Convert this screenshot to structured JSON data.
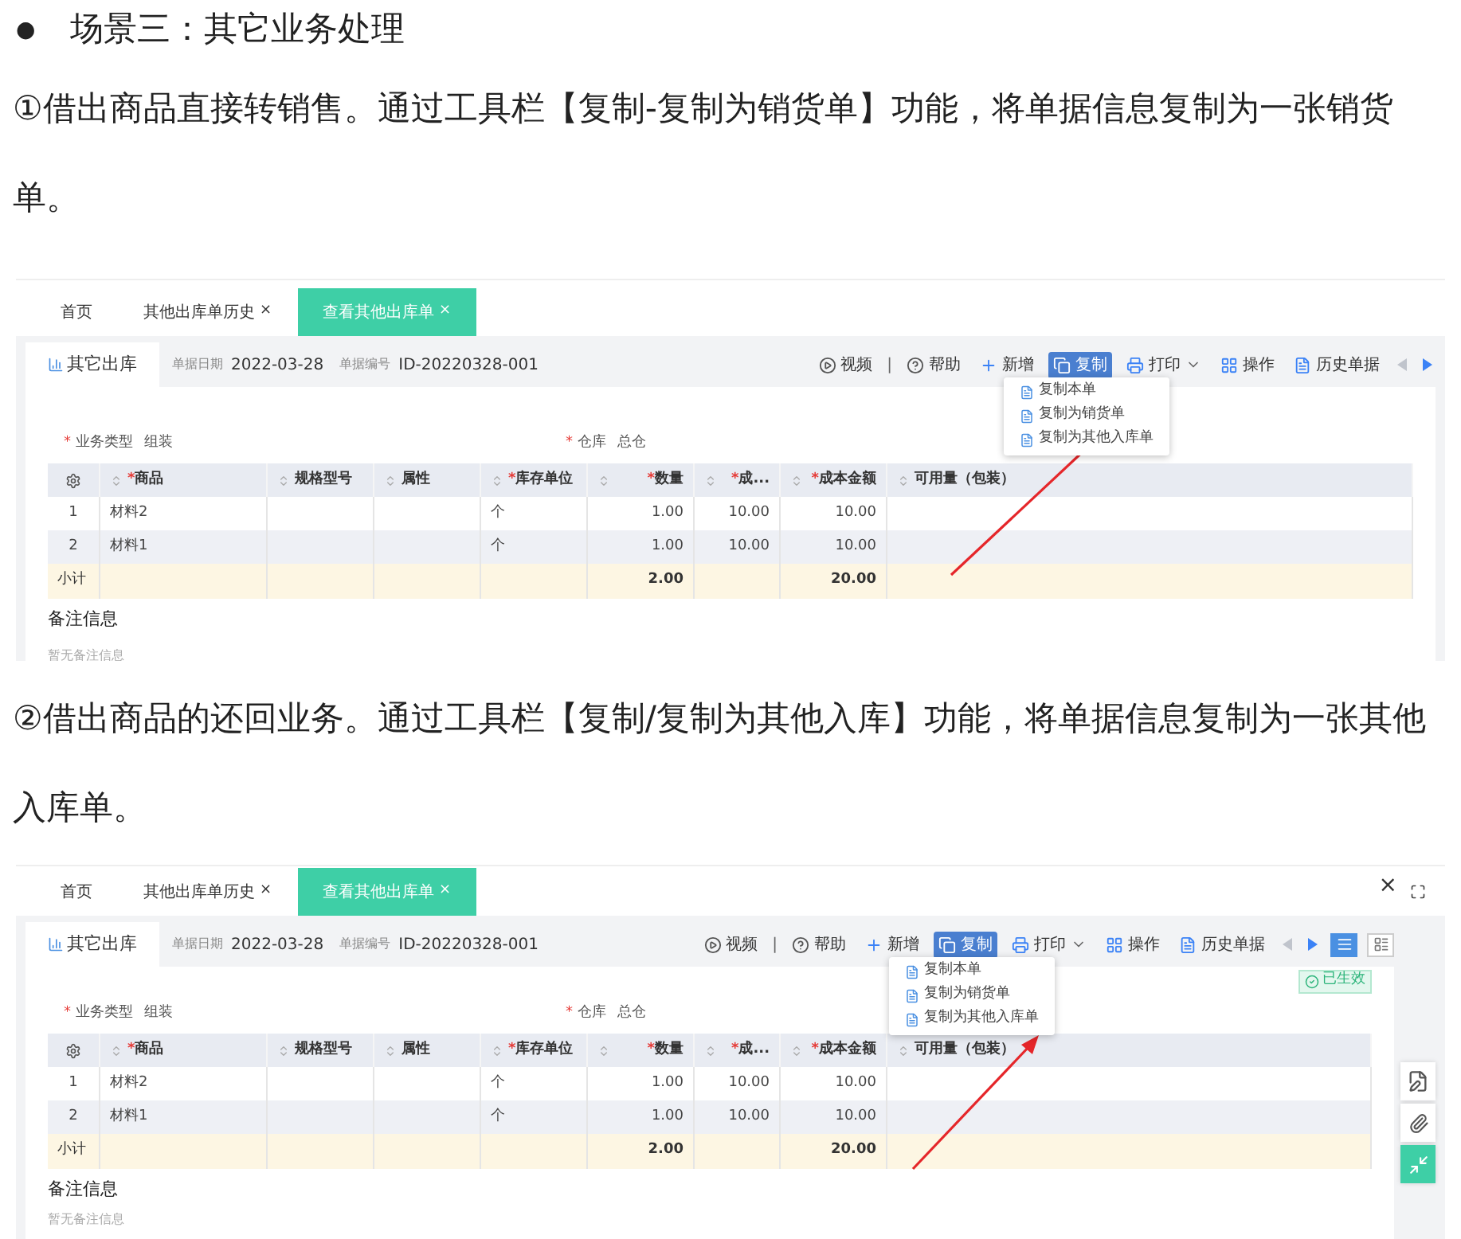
{
  "heading": {
    "bullet": "●",
    "text": "场景三：其它业务处理"
  },
  "sections": [
    {
      "instruction": "①借出商品直接转销售。通过工具栏【复制-复制为销货单】功能，将单据信息复制为一张销货单。",
      "screenshot": {
        "tabs": [
          {
            "label": "首页",
            "selected": false
          },
          {
            "label": "其他出库单历史",
            "close": "×",
            "selected": false
          },
          {
            "label": "查看其他出库单",
            "close": "×",
            "selected": true
          }
        ],
        "doc_tab": "其它出库",
        "date_label": "单据日期",
        "date": "2022-03-28",
        "number_label": "单据编号",
        "number": "ID-20220328-001",
        "toolbar": [
          {
            "kind": "video",
            "label": "视频"
          },
          {
            "kind": "separator",
            "label": "|"
          },
          {
            "kind": "help",
            "label": "帮助"
          },
          {
            "kind": "new",
            "label": "新增"
          },
          {
            "kind": "copy",
            "label": "复制",
            "selected": true,
            "menu": [
              "复制本单",
              "复制为销货单",
              "复制为其他入库单"
            ]
          },
          {
            "kind": "print",
            "label": "打印"
          },
          {
            "kind": "operate",
            "label": "操作"
          },
          {
            "kind": "history",
            "label": "历史单据"
          },
          {
            "kind": "prev"
          },
          {
            "kind": "next"
          }
        ],
        "fields": [
          {
            "mark": "*",
            "label": "业务类型",
            "value": "组装"
          },
          {
            "mark": "*",
            "label": "仓库",
            "value": "总仓"
          }
        ],
        "table": {
          "columns": [
            {
              "kind": "settings"
            },
            {
              "mark": "*",
              "label": "商品"
            },
            {
              "label": "规格型号"
            },
            {
              "label": "属性"
            },
            {
              "mark": "*",
              "label": "库存单位"
            },
            {
              "mark": "*",
              "label": "数量"
            },
            {
              "mark": "*",
              "label": "成..."
            },
            {
              "mark": "*",
              "label": "成本金额"
            },
            {
              "label": "可用量（包装）"
            }
          ],
          "rows": [
            {
              "index": "1",
              "product": "材料2",
              "unit": "个",
              "qty": "1.00",
              "cost": "10.00",
              "amount": "10.00"
            },
            {
              "index": "2",
              "product": "材料1",
              "unit": "个",
              "qty": "1.00",
              "cost": "10.00",
              "amount": "10.00"
            }
          ],
          "subtotal": {
            "label": "小计",
            "qty": "2.00",
            "amount": "20.00"
          }
        },
        "remarks_title": "备注信息",
        "remarks": "暂无备注信息",
        "pointer_arrow": true
      }
    },
    {
      "instruction": "②借出商品的还回业务。通过工具栏【复制/复制为其他入库】功能，将单据信息复制为一张其他入库单。",
      "screenshot": {
        "tabs": [
          {
            "label": "首页",
            "selected": false
          },
          {
            "label": "其他出库单历史",
            "close": "×",
            "selected": false
          },
          {
            "label": "查看其他出库单",
            "close": "×",
            "selected": true
          }
        ],
        "window_controls": [
          {
            "kind": "close",
            "label": "×"
          },
          {
            "kind": "fullscreen"
          }
        ],
        "doc_tab": "其它出库",
        "date_label": "单据日期",
        "date": "2022-03-28",
        "number_label": "单据编号",
        "number": "ID-20220328-001",
        "toolbar": [
          {
            "kind": "video",
            "label": "视频"
          },
          {
            "kind": "separator",
            "label": "|"
          },
          {
            "kind": "help",
            "label": "帮助"
          },
          {
            "kind": "new",
            "label": "新增"
          },
          {
            "kind": "copy",
            "label": "复制",
            "selected": true,
            "menu": [
              "复制本单",
              "复制为销货单",
              "复制为其他入库单"
            ]
          },
          {
            "kind": "print",
            "label": "打印"
          },
          {
            "kind": "operate",
            "label": "操作"
          },
          {
            "kind": "history",
            "label": "历史单据"
          },
          {
            "kind": "prev"
          },
          {
            "kind": "next"
          },
          {
            "kind": "list-view",
            "selected": true
          },
          {
            "kind": "card-view",
            "selected": false
          }
        ],
        "status_badge": "已生效",
        "fields": [
          {
            "mark": "*",
            "label": "业务类型",
            "value": "组装"
          },
          {
            "mark": "*",
            "label": "仓库",
            "value": "总仓"
          }
        ],
        "table": {
          "columns": [
            {
              "kind": "settings"
            },
            {
              "mark": "*",
              "label": "商品"
            },
            {
              "label": "规格型号"
            },
            {
              "label": "属性"
            },
            {
              "mark": "*",
              "label": "库存单位"
            },
            {
              "mark": "*",
              "label": "数量"
            },
            {
              "mark": "*",
              "label": "成..."
            },
            {
              "mark": "*",
              "label": "成本金额"
            },
            {
              "label": "可用量（包装）"
            }
          ],
          "rows": [
            {
              "index": "1",
              "product": "材料2",
              "unit": "个",
              "qty": "1.00",
              "cost": "10.00",
              "amount": "10.00"
            },
            {
              "index": "2",
              "product": "材料1",
              "unit": "个",
              "qty": "1.00",
              "cost": "10.00",
              "amount": "10.00"
            }
          ],
          "subtotal": {
            "label": "小计",
            "qty": "2.00",
            "amount": "20.00"
          }
        },
        "side_tools": [
          {
            "kind": "note",
            "selected": false
          },
          {
            "kind": "attach",
            "selected": false
          },
          {
            "kind": "collapse",
            "selected": true
          }
        ],
        "remarks_title": "备注信息",
        "remarks": "暂无备注信息",
        "pointer_arrow": true
      }
    }
  ]
}
